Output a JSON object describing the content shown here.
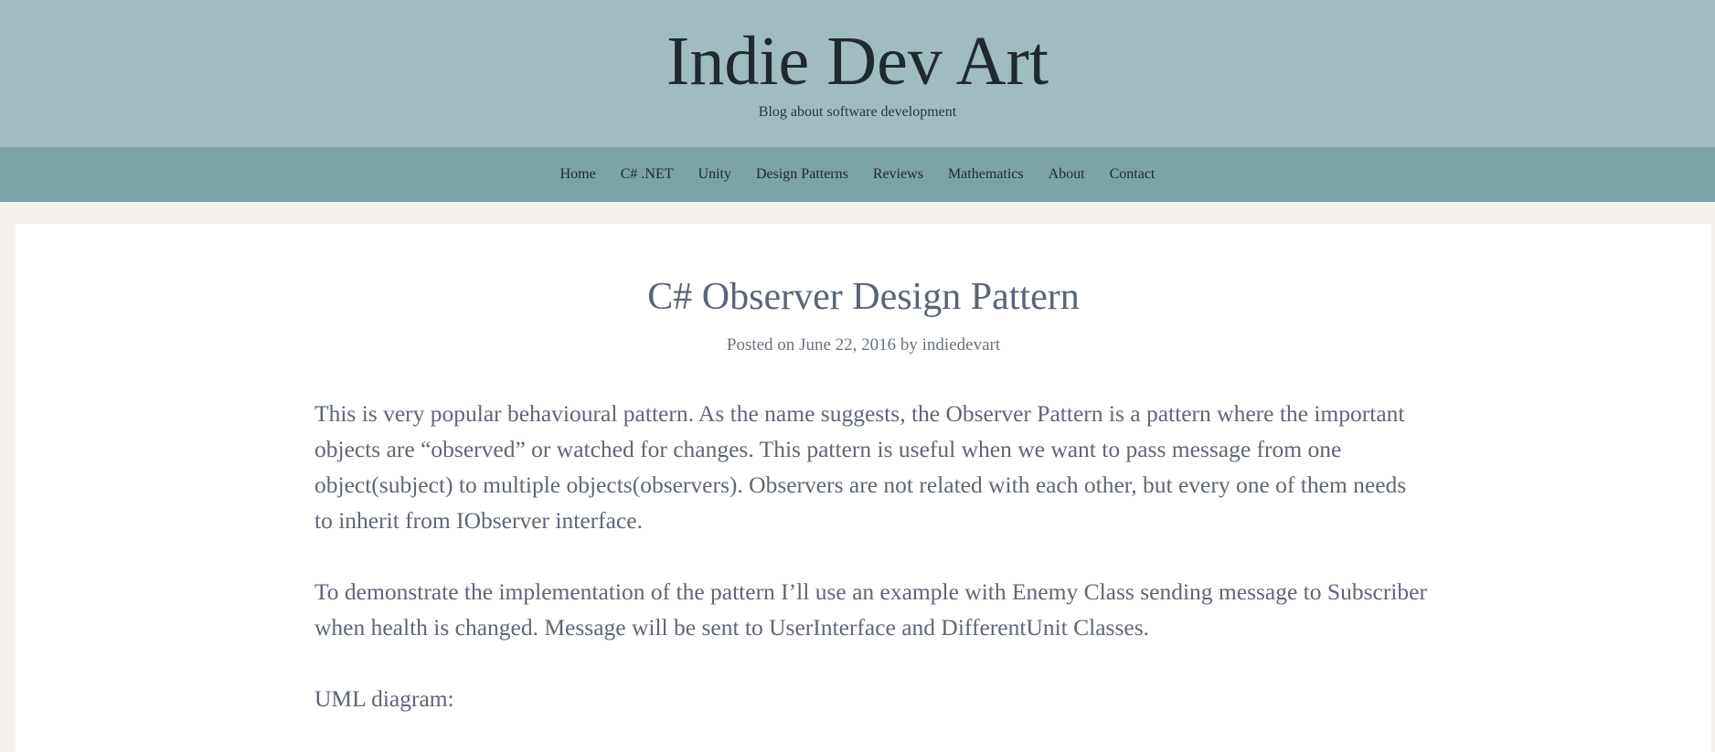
{
  "header": {
    "title": "Indie Dev Art",
    "description": "Blog about software development"
  },
  "nav": {
    "items": [
      "Home",
      "C# .NET",
      "Unity",
      "Design Patterns",
      "Reviews",
      "Mathematics",
      "About",
      "Contact"
    ]
  },
  "post": {
    "title": "C# Observer Design Pattern",
    "meta": {
      "prefix": "Posted on",
      "date": "June 22, 2016",
      "by": "by",
      "author": "indiedevart"
    },
    "paragraphs": [
      "This is very popular behavioural pattern. As the name suggests, the Observer Pattern is a pattern where the important objects are “observed” or watched for changes. This pattern is useful when we want to pass message from one object(subject) to multiple objects(observers).  Observers are not related with each other, but every one of them needs to inherit from IObserver interface.",
      "To demonstrate the implementation of the pattern I’ll use an example with Enemy Class sending message to Subscriber when health is changed. Message will be sent to UserInterface and DifferentUnit Classes.",
      "UML diagram:"
    ]
  },
  "colors": {
    "header_bg": "#9fbdc0",
    "nav_bg": "#7aa4a6",
    "page_bg": "#f4f1ec",
    "text": "#5f6676"
  }
}
